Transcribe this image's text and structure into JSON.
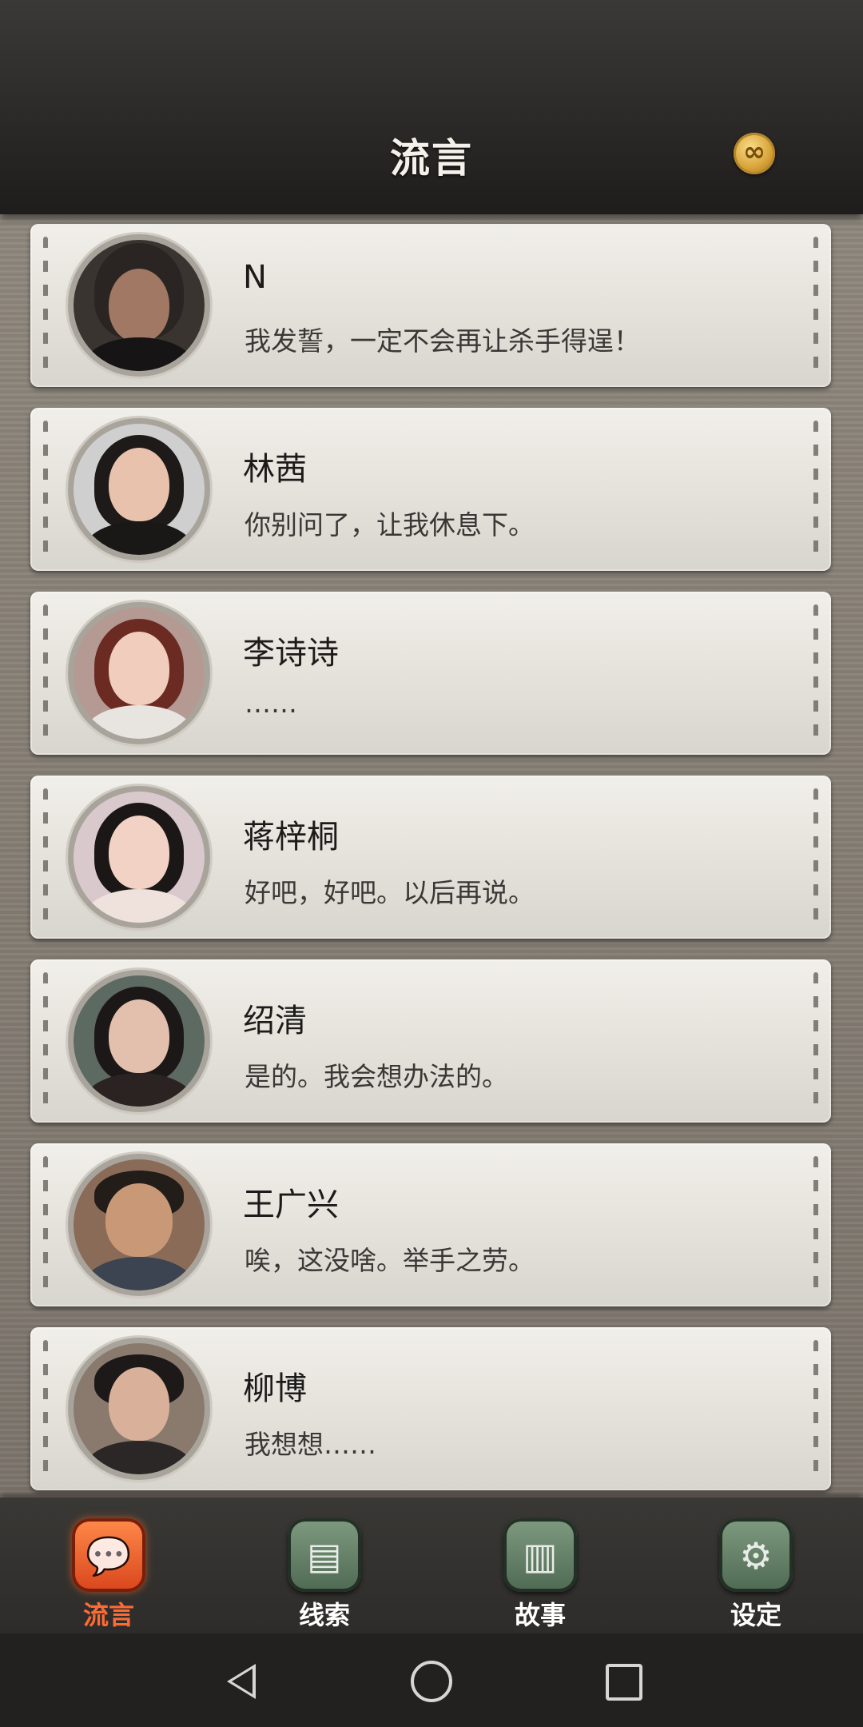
{
  "header": {
    "title": "流言",
    "coin_icon": "infinity-coin-icon"
  },
  "contacts": [
    {
      "name": "N",
      "message": "我发誓，一定不会再让杀手得逞！"
    },
    {
      "name": "林茜",
      "message": "你别问了，让我休息下。"
    },
    {
      "name": "李诗诗",
      "message": "……"
    },
    {
      "name": "蒋梓桐",
      "message": "好吧，好吧。以后再说。"
    },
    {
      "name": "绍清",
      "message": "是的。我会想办法的。"
    },
    {
      "name": "王广兴",
      "message": "唉，这没啥。举手之劳。"
    },
    {
      "name": "柳博",
      "message": "我想想……"
    }
  ],
  "tabs": [
    {
      "label": "流言",
      "icon": "chat-bubble-icon",
      "active": true
    },
    {
      "label": "线索",
      "icon": "papers-icon",
      "active": false
    },
    {
      "label": "故事",
      "icon": "book-icon",
      "active": false
    },
    {
      "label": "设定",
      "icon": "gear-icon",
      "active": false
    }
  ],
  "system_nav": {
    "back": "back-icon",
    "home": "home-icon",
    "recent": "recent-apps-icon"
  },
  "colors": {
    "active_tab": "#ff6a33",
    "tab_icon_green": "#5f7b62",
    "card": "#ebe8e2",
    "header": "#2c2a28"
  }
}
